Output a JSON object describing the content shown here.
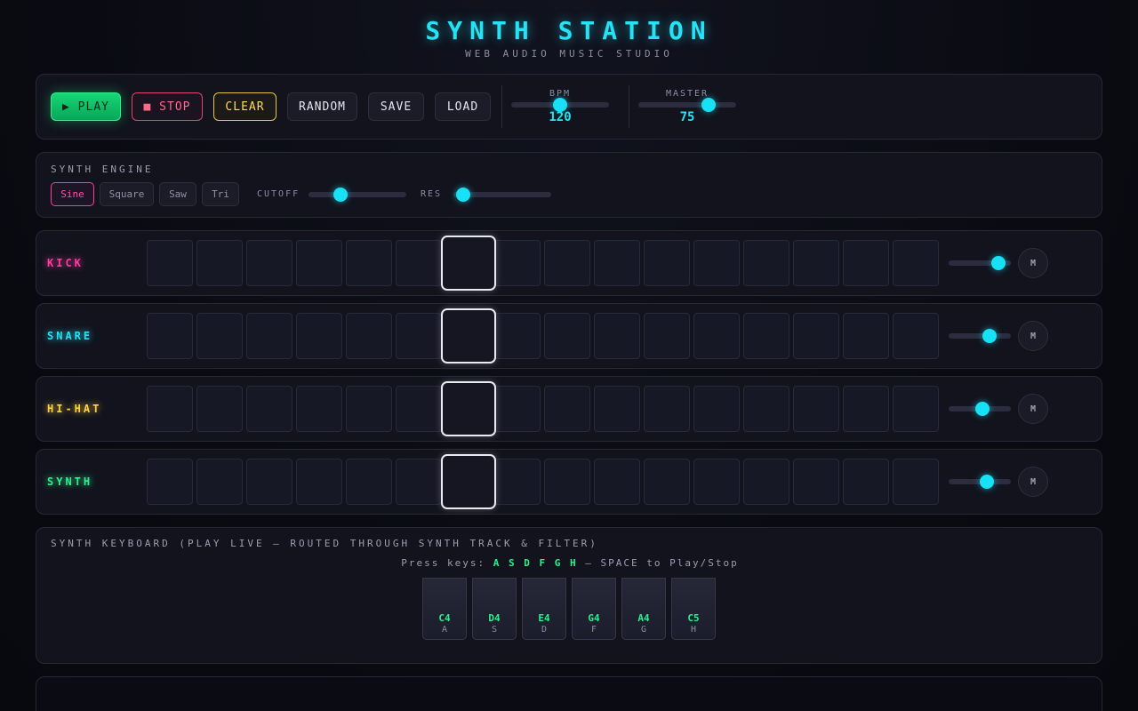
{
  "header": {
    "title": "SYNTH STATION",
    "subtitle": "WEB AUDIO MUSIC STUDIO"
  },
  "transport": {
    "play_label": "▶ PLAY",
    "stop_label": "■ STOP",
    "clear_label": "CLEAR",
    "random_label": "RANDOM",
    "save_label": "SAVE",
    "load_label": "LOAD",
    "bpm": {
      "label": "BPM",
      "value": "120",
      "level": 0.5
    },
    "master": {
      "label": "MASTER",
      "value": "75",
      "level": 0.72
    }
  },
  "engine": {
    "title": "SYNTH ENGINE",
    "waves": [
      {
        "label": "Sine",
        "active": true
      },
      {
        "label": "Square",
        "active": false
      },
      {
        "label": "Saw",
        "active": false
      },
      {
        "label": "Tri",
        "active": false
      }
    ],
    "cutoff": {
      "label": "CUTOFF",
      "level": 0.33
    },
    "res": {
      "label": "RES",
      "level": 0.1
    }
  },
  "sequencer": {
    "steps": 16,
    "current_step": 7,
    "tracks": [
      {
        "name": "KICK",
        "color": "#ff3aa0",
        "volume": 0.8,
        "mute_label": "M"
      },
      {
        "name": "SNARE",
        "color": "#25e3f5",
        "volume": 0.66,
        "mute_label": "M"
      },
      {
        "name": "HI-HAT",
        "color": "#ffd23f",
        "volume": 0.54,
        "mute_label": "M"
      },
      {
        "name": "SYNTH",
        "color": "#2ef08f",
        "volume": 0.61,
        "mute_label": "M"
      }
    ]
  },
  "keyboard": {
    "title": "SYNTH KEYBOARD (PLAY LIVE — ROUTED THROUGH SYNTH TRACK & FILTER)",
    "hint_prefix": "Press keys:",
    "hint_keys": "A S D F G H",
    "hint_suffix": "— SPACE to Play/Stop",
    "keys": [
      {
        "note": "C4",
        "key": "A"
      },
      {
        "note": "D4",
        "key": "S"
      },
      {
        "note": "E4",
        "key": "D"
      },
      {
        "note": "G4",
        "key": "F"
      },
      {
        "note": "A4",
        "key": "G"
      },
      {
        "note": "C5",
        "key": "H"
      }
    ]
  }
}
